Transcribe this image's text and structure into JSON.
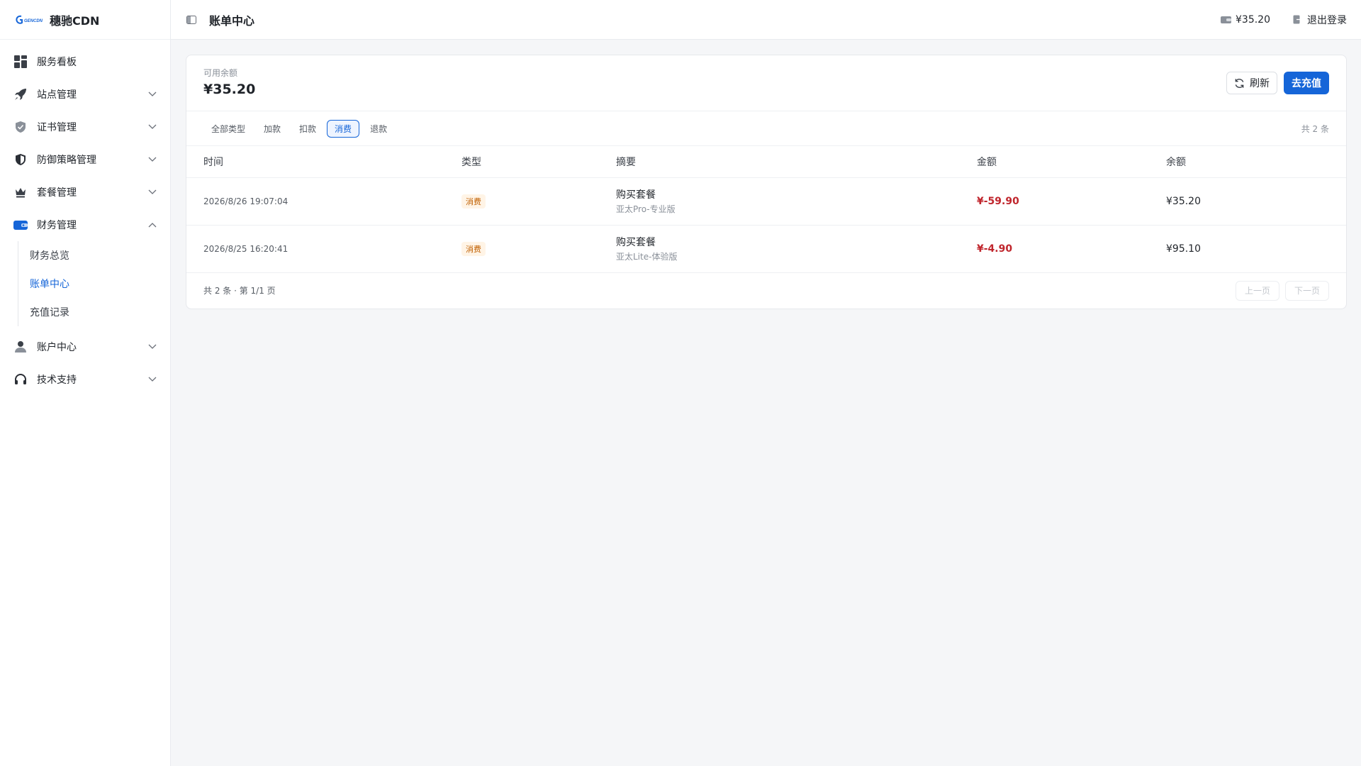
{
  "brand": {
    "logo_text": "GENCDN",
    "name": "穗驰CDN"
  },
  "sidebar": {
    "items": [
      {
        "label": "服务看板",
        "icon": "dashboard-icon"
      },
      {
        "label": "站点管理",
        "icon": "rocket-icon"
      },
      {
        "label": "证书管理",
        "icon": "shield-check-icon"
      },
      {
        "label": "防御策略管理",
        "icon": "shield-half-icon"
      },
      {
        "label": "套餐管理",
        "icon": "crown-icon"
      },
      {
        "label": "财务管理",
        "icon": "wallet-icon"
      },
      {
        "label": "账户中心",
        "icon": "user-icon"
      },
      {
        "label": "技术支持",
        "icon": "headset-icon"
      }
    ],
    "finance_sub": [
      {
        "label": "财务总览"
      },
      {
        "label": "账单中心"
      },
      {
        "label": "充值记录"
      }
    ]
  },
  "header": {
    "title": "账单中心",
    "balance": "¥35.20",
    "logout": "退出登录"
  },
  "balance_card": {
    "label": "可用余额",
    "value": "¥35.20",
    "refresh": "刷新",
    "topup": "去充值"
  },
  "filters": {
    "chips": [
      "全部类型",
      "加款",
      "扣款",
      "消费",
      "退款"
    ],
    "active": "消费",
    "total": "共 2 条"
  },
  "table": {
    "headers": [
      "时间",
      "类型",
      "摘要",
      "金额",
      "余额"
    ],
    "rows": [
      {
        "time": "2026/8/26 19:07:04",
        "type": "消费",
        "summary": "购买套餐",
        "detail": "亚太Pro-专业版",
        "amount": "¥-59.90",
        "balance": "¥35.20"
      },
      {
        "time": "2026/8/25 16:20:41",
        "type": "消费",
        "summary": "购买套餐",
        "detail": "亚太Lite-体验版",
        "amount": "¥-4.90",
        "balance": "¥95.10"
      }
    ]
  },
  "pager": {
    "info": "共 2 条 · 第 1/1 页",
    "prev": "上一页",
    "next": "下一页"
  },
  "colors": {
    "accent": "#1565d8",
    "negative": "#c0262d",
    "tag_bg": "#fff4e6",
    "tag_text": "#c05f00"
  }
}
